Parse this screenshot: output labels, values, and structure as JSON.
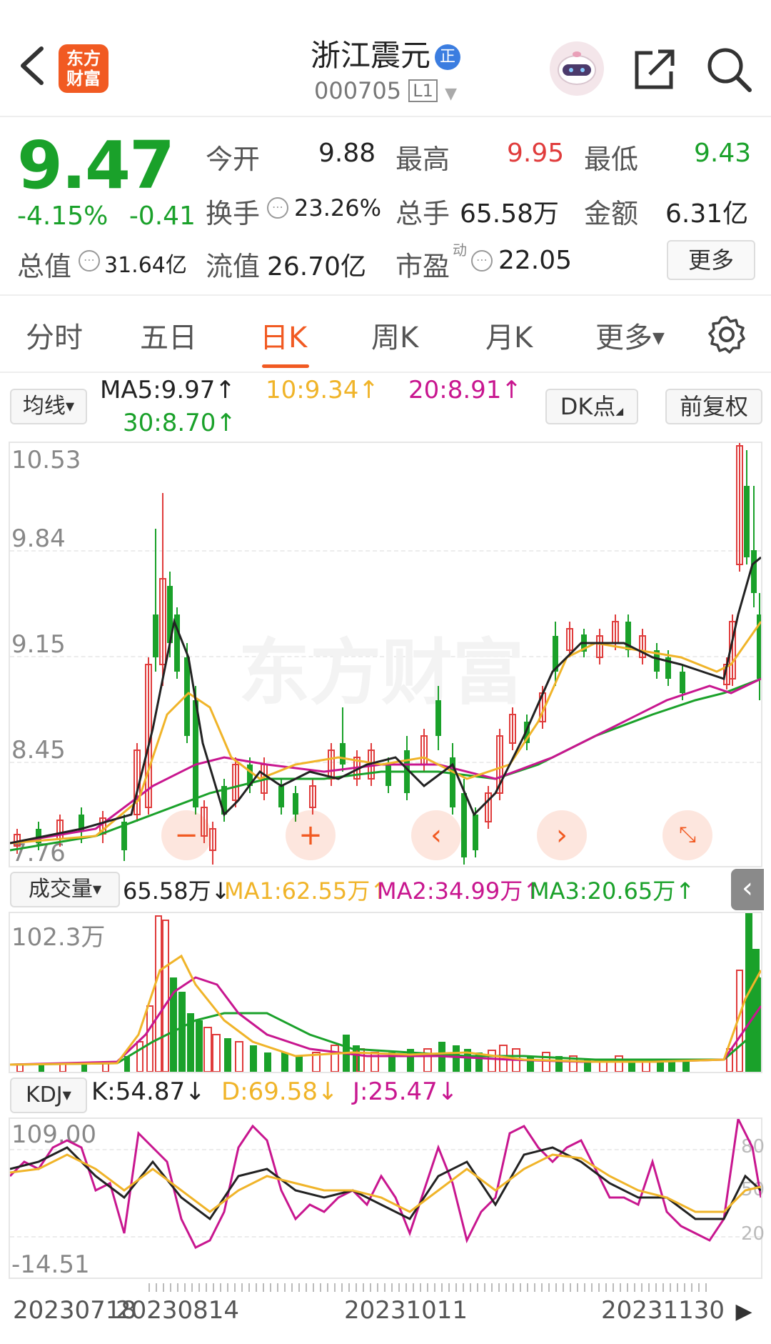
{
  "header": {
    "logo_text_1": "东方",
    "logo_text_2": "财富",
    "stock_name": "浙江震元",
    "badge": "正",
    "stock_code": "000705",
    "level": "L1"
  },
  "quote": {
    "price": "9.47",
    "change_pct": "-4.15%",
    "change_amt": "-0.41",
    "fields": {
      "open_label": "今开",
      "open_value": "9.88",
      "high_label": "最高",
      "high_value": "9.95",
      "low_label": "最低",
      "low_value": "9.43",
      "turnover_label": "换手",
      "turnover_value": "23.26%",
      "volume_label": "总手",
      "volume_value": "65.58万",
      "amount_label": "金额",
      "amount_value": "6.31亿",
      "mcap_label": "总值",
      "mcap_value": "31.64亿",
      "float_label": "流值",
      "float_value": "26.70亿",
      "pe_label": "市盈",
      "pe_sup": "动",
      "pe_value": "22.05"
    },
    "more_button": "更多"
  },
  "tabs": [
    {
      "label": "分时"
    },
    {
      "label": "五日"
    },
    {
      "label": "日K"
    },
    {
      "label": "周K"
    },
    {
      "label": "月K"
    },
    {
      "label": "更多"
    }
  ],
  "active_tab": "日K",
  "colors": {
    "up": "#e03c3c",
    "down": "#1aa12a",
    "ma5": "#222222",
    "ma10": "#f0b429",
    "ma20": "#c8168f",
    "ma30": "#1aa12a",
    "accent": "#f15a22"
  },
  "ma_bar": {
    "selector": "均线",
    "ma5": "MA5:9.97",
    "ma10": "10:9.34",
    "ma20": "20:8.91",
    "ma30": "30:8.70",
    "dk_button": "DK点",
    "adjust_button": "前复权"
  },
  "kline": {
    "y_labels": [
      "10.53",
      "9.84",
      "9.15",
      "8.45",
      "7.76"
    ],
    "watermark": "东方财富"
  },
  "volume_bar": {
    "selector": "成交量",
    "value": "65.58万",
    "ma1": "MA1:62.55万",
    "ma2": "MA2:34.99万",
    "ma3": "MA3:20.65万",
    "y_label": "102.3万"
  },
  "kdj_bar": {
    "selector": "KDJ",
    "k": "K:54.87",
    "d": "D:69.58",
    "j": "J:25.47",
    "y_top": "109.00",
    "y_bottom": "-14.51",
    "r80": "80",
    "r50": "50",
    "r20": "20"
  },
  "dates": [
    "20230718",
    "20230814",
    "20231011",
    "20231130"
  ]
}
